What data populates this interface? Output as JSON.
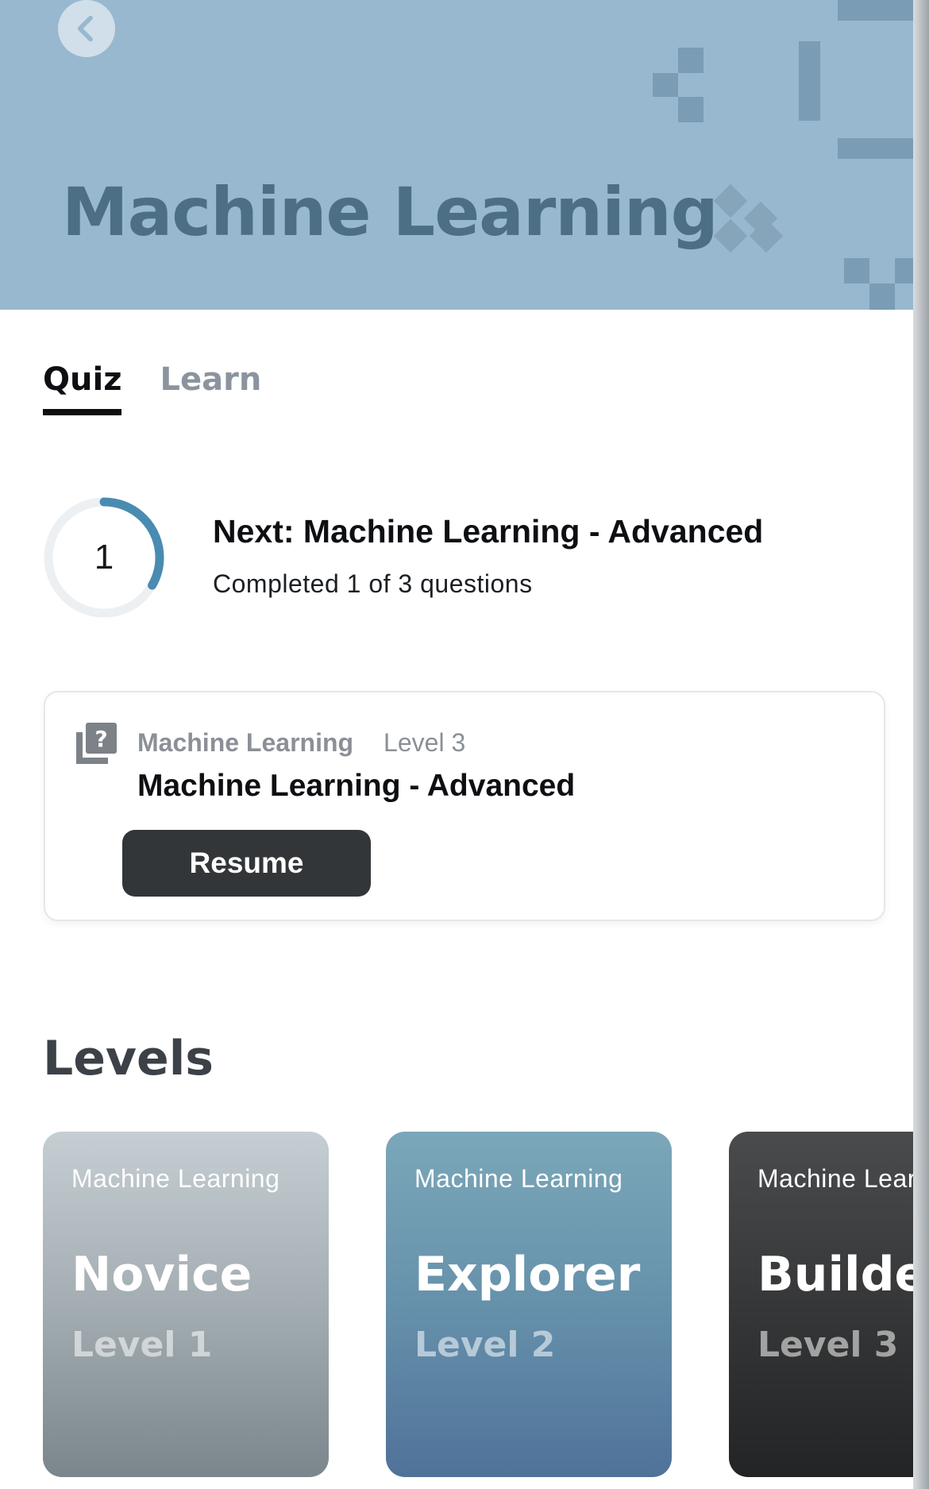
{
  "header": {
    "title": "Machine Learning",
    "background_color": "#98b8cf",
    "back_icon": "chevron-left-icon"
  },
  "tabs": [
    {
      "label": "Quiz",
      "active": true
    },
    {
      "label": "Learn",
      "active": false
    }
  ],
  "progress": {
    "count": "1",
    "completed": 1,
    "total": 3,
    "fraction": 0.3333,
    "accent_color": "#4a8bb1",
    "next_title": "Next: Machine Learning  - Advanced",
    "subtitle": "Completed 1 of 3 questions"
  },
  "resume_card": {
    "icon": "quiz-question-icon",
    "topic": "Machine Learning",
    "level": "Level 3",
    "title": "Machine Learning  - Advanced",
    "button_label": "Resume"
  },
  "levels": {
    "heading": "Levels",
    "cards": [
      {
        "topic": "Machine Learning",
        "name": "Novice",
        "level": "Level 1"
      },
      {
        "topic": "Machine Learning",
        "name": "Explorer",
        "level": "Level 2"
      },
      {
        "topic": "Machine Learning",
        "name": "Builder",
        "level": "Level 3"
      }
    ]
  }
}
